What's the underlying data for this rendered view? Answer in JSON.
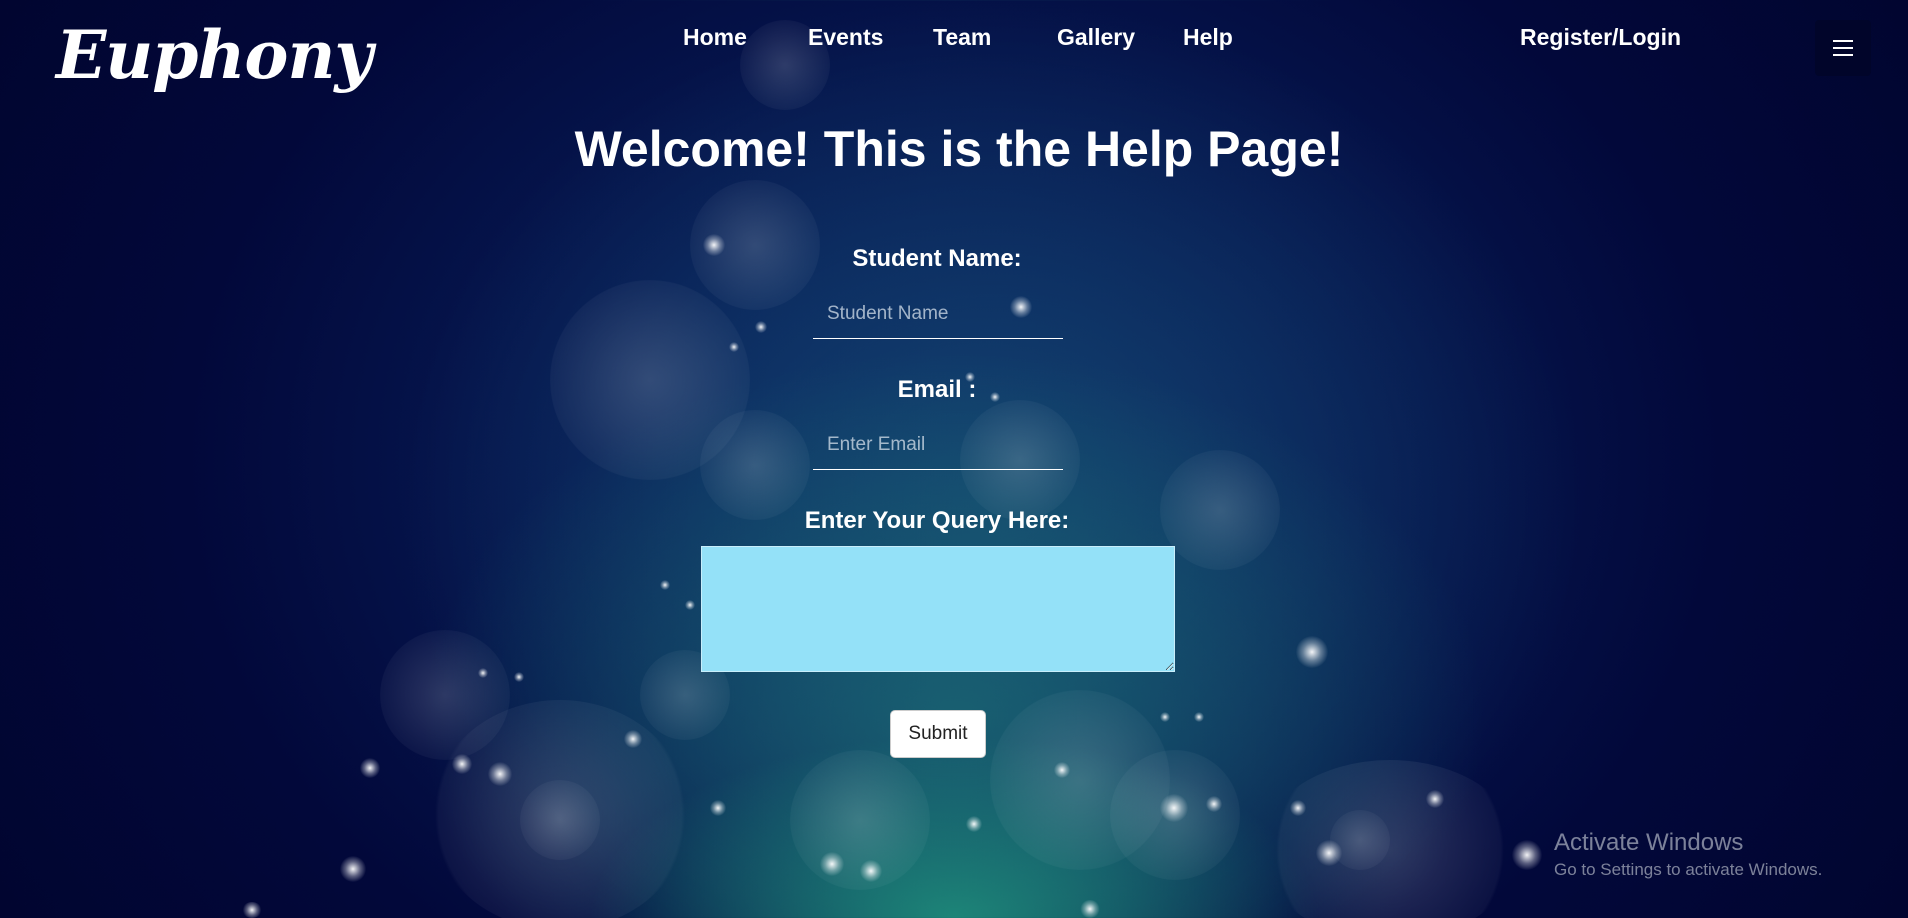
{
  "brand": {
    "logo_text": "Euphony"
  },
  "nav": {
    "home": "Home",
    "events": "Events",
    "team": "Team",
    "gallery": "Gallery",
    "help": "Help",
    "register_login": "Register/Login",
    "menu_icon": "hamburger-menu-icon"
  },
  "main": {
    "title": "Welcome! This is the Help Page!"
  },
  "form": {
    "student_name_label": "Student Name:",
    "student_name_placeholder": "Student Name",
    "student_name_value": "",
    "email_label": "Email :",
    "email_placeholder": "Enter Email",
    "email_value": "",
    "query_label": "Enter Your Query Here:",
    "query_value": "",
    "submit_label": "Submit"
  },
  "watermark": {
    "title": "Activate Windows",
    "subtitle": "Go to Settings to activate Windows."
  },
  "colors": {
    "background_deep": "#010530",
    "background_glow": "#1e7878",
    "query_area": "#94e1f8",
    "text": "#ffffff"
  }
}
